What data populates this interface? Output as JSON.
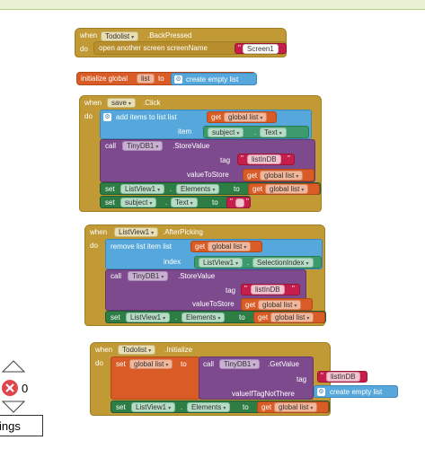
{
  "colors": {
    "event": "#c19a35",
    "variable": "#d95c26",
    "list": "#56a8dc",
    "component": "#7d4a8e",
    "setter": "#2e7d45",
    "text": "#c61e4a"
  },
  "icons": [
    "gear-icon",
    "up-arrow-icon",
    "error-x-icon",
    "down-arrow-icon"
  ],
  "b1": {
    "when": "when",
    "comp": "Todolist",
    "event": ".BackPressed",
    "do": "do",
    "action": "open another screen  screenName",
    "value": "Screen1"
  },
  "b2": {
    "init": "initialize global",
    "name": "list",
    "to": "to",
    "create": "create empty list"
  },
  "b3": {
    "when": "when",
    "comp": "save",
    "event": ".Click",
    "do": "do",
    "add": "add items to list  list",
    "get": "get",
    "gvar": "global list",
    "item": "item",
    "subject": "subject",
    "text": "Text",
    "call": "call",
    "tinydb": "TinyDB1",
    "store": ".StoreValue",
    "tag": "tag",
    "tagval": "listInDB",
    "vts": "valueToStore",
    "set": "set",
    "lv": "ListView1",
    "elements": "Elements",
    "to": "to"
  },
  "b4": {
    "when": "when",
    "comp": "ListView1",
    "event": ".AfterPicking",
    "do": "do",
    "remove": "remove list item  list",
    "index": "index",
    "sel": "SelectionIndex"
  },
  "b5": {
    "when": "when",
    "comp": "Todolist",
    "event": ".Initialize",
    "do": "do",
    "set": "set",
    "get": "get",
    "gvar": "global list",
    "to": "to",
    "call": "call",
    "tinydb": "TinyDB1",
    "getval": ".GetValue",
    "tag": "tag",
    "tagval": "listInDB",
    "vint": "valueIfTagNotThere",
    "create": "create empty list",
    "lv": "ListView1",
    "elements": "Elements"
  },
  "controls": {
    "errors": "0",
    "warnings": "ings"
  }
}
